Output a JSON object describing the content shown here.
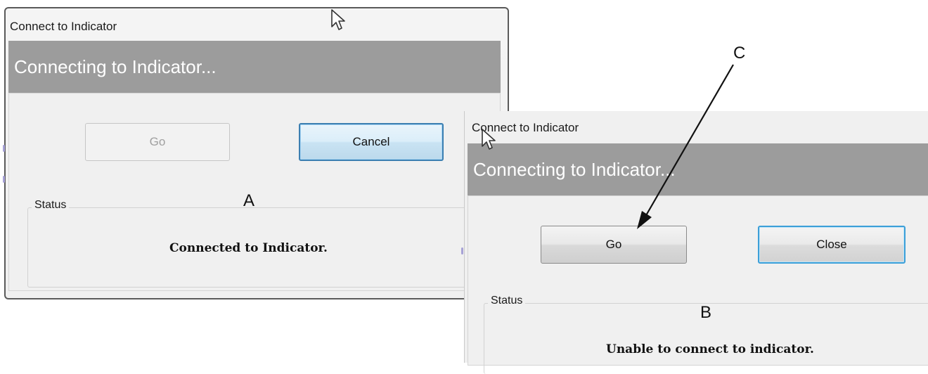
{
  "dialog_a": {
    "window_title": "Connect to Indicator",
    "banner": "Connecting to Indicator...",
    "go_label": "Go",
    "cancel_label": "Cancel",
    "status_group_label": "Status",
    "status_message": "Connected to Indicator.",
    "callout": "A"
  },
  "dialog_b": {
    "window_title": "Connect to Indicator",
    "banner": "Connecting to Indicator...",
    "go_label": "Go",
    "close_label": "Close",
    "status_group_label": "Status",
    "status_message": "Unable to connect to indicator.",
    "callout": "B"
  },
  "arrow_callout": "C",
  "icons": [
    "mouse-pointer-icon",
    "mouse-pointer-icon"
  ],
  "colors": {
    "banner_bg": "#9c9c9c",
    "dialog_bg": "#f0f0f0",
    "focus_border": "#3c7fb1"
  }
}
